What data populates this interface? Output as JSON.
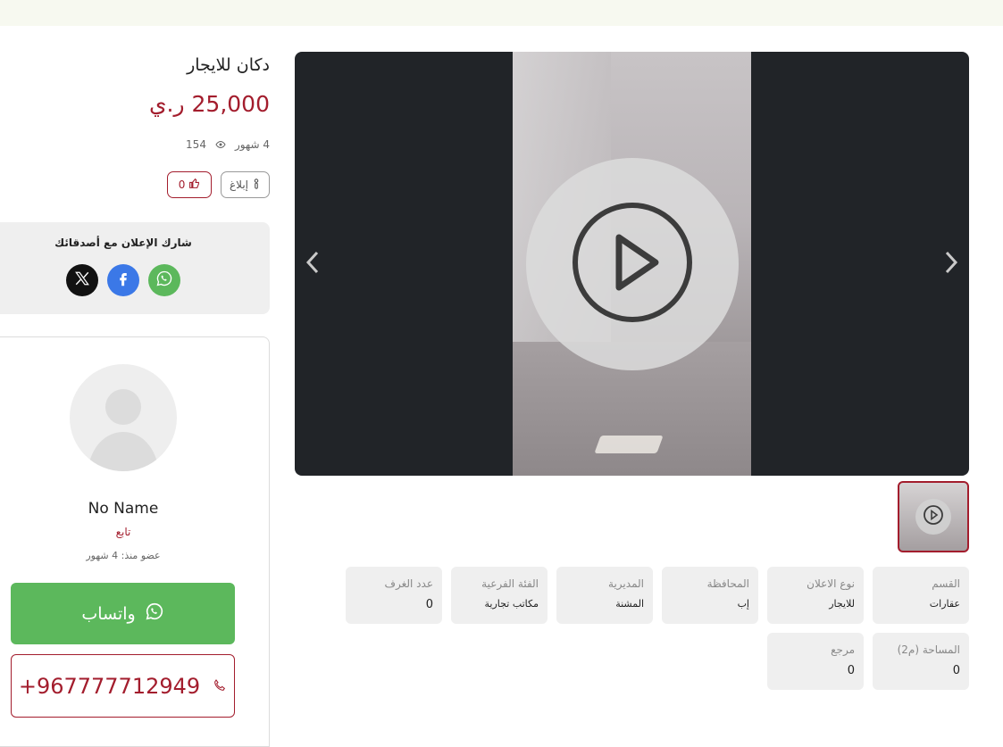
{
  "listing": {
    "title": "دكان للايجار",
    "price": "25,000 ر.ي",
    "age": "4 شهور",
    "views": "154",
    "report_label": "إبلاغ",
    "likes": "0"
  },
  "share": {
    "title": "شارك الإعلان مع أصدقائك",
    "networks": [
      "x-icon",
      "facebook-icon",
      "whatsapp-icon"
    ]
  },
  "profile": {
    "name": "No Name",
    "follow_label": "تابع",
    "member_since": "عضو منذ: 4 شهور",
    "whatsapp_label": "واتساب",
    "phone": "+967777712949"
  },
  "media": {
    "prev_icon": "chevron-left-icon",
    "next_icon": "chevron-right-icon",
    "play_icon": "play-icon"
  },
  "details": [
    {
      "label": "القسم",
      "value": "عقارات"
    },
    {
      "label": "نوع الاعلان",
      "value": "للايجار"
    },
    {
      "label": "المحافظة",
      "value": "إب"
    },
    {
      "label": "المديرية",
      "value": "المشنة"
    },
    {
      "label": "الفئة الفرعية",
      "value": "مكاتب تجارية"
    },
    {
      "label": "عدد الغرف",
      "value": "0"
    },
    {
      "label": "المساحة (م2)",
      "value": "0"
    },
    {
      "label": "مرجع",
      "value": "0"
    }
  ],
  "colors": {
    "brand": "#a31d2d",
    "whatsapp": "#5cb85c",
    "facebook": "#3b78e7",
    "top_bar": "#f7f9f0"
  }
}
